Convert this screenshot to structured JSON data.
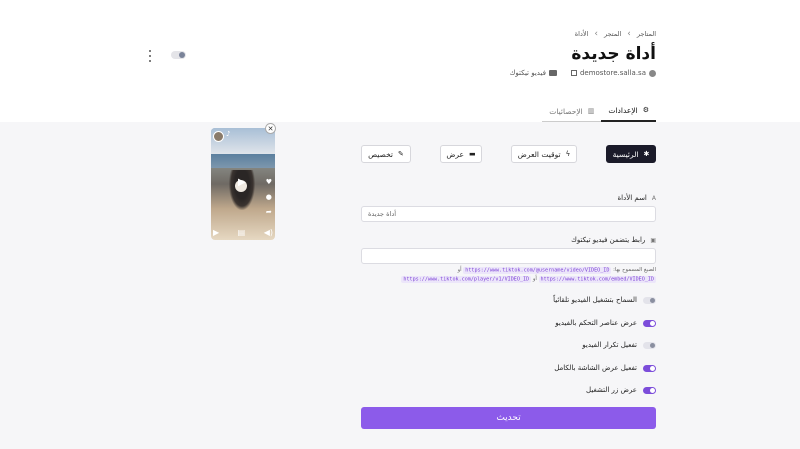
{
  "breadcrumb": {
    "items": [
      "المتاجر",
      "المتجر",
      "الأداة"
    ]
  },
  "page_title": "أداة جديدة",
  "meta": {
    "store": "demostore.salla.sa",
    "widget_type": "فيديو تيكتوك"
  },
  "tabs": [
    {
      "label": "الإعدادات",
      "active": true
    },
    {
      "label": "الإحصائيات",
      "active": false
    }
  ],
  "actions": {
    "main": "الرئيسية",
    "schedule": "توقيت العرض",
    "display": "عرض",
    "customize": "تخصيص"
  },
  "form": {
    "name_label": "اسم الأداة",
    "name_value": "أداة جديدة",
    "url_label": "رابط يتضمن فيديو تيكتوك",
    "url_value": "",
    "hint_prefix": "الصيغ المسموح بها:",
    "hint_or": "أو",
    "formats": [
      "https://www.tiktok.com/@username/video/VIDEO_ID",
      "https://www.tiktok.com/player/v1/VIDEO_ID",
      "https://www.tiktok.com/embed/VIDEO_ID"
    ]
  },
  "toggles": [
    {
      "label": "السماح بتشغيل الفيديو تلقائياً",
      "on": false
    },
    {
      "label": "عرض عناصر التحكم بالفيديو",
      "on": true
    },
    {
      "label": "تفعيل تكرار الفيديو",
      "on": false
    },
    {
      "label": "تفعيل عرض الشاشة بالكامل",
      "on": true
    },
    {
      "label": "عرض زر التشغيل",
      "on": true
    }
  ],
  "submit_label": "تحديث",
  "colors": {
    "accent": "#8c5bea",
    "dark_button": "#1b1b2a"
  },
  "icons": {
    "settings_tab": "gear-pair-icon",
    "stats_tab": "bar-chart-icon",
    "main": "gear-icon",
    "schedule": "bolt-icon",
    "display": "window-icon",
    "customize": "pencil-icon"
  }
}
